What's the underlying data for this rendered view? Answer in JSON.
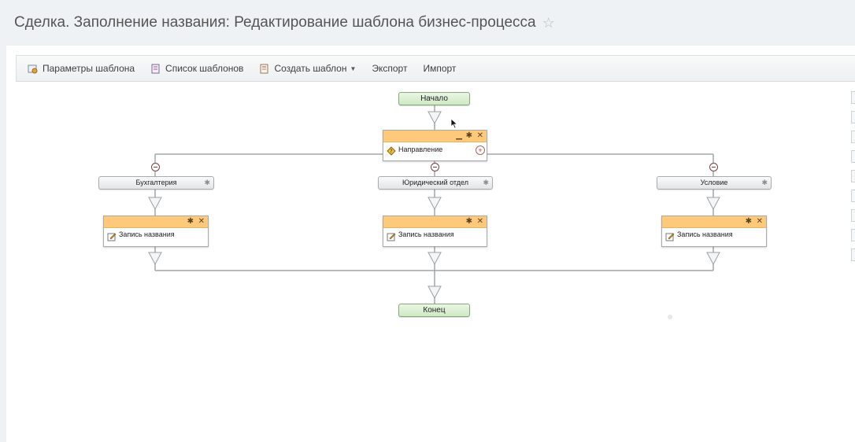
{
  "page": {
    "title": "Сделка. Заполнение названия: Редактирование шаблона бизнес-процесса"
  },
  "toolbar": {
    "template_params": "Параметры шаблона",
    "template_list": "Список шаблонов",
    "create_template": "Создать шаблон",
    "export": "Экспорт",
    "import": "Импорт"
  },
  "diagram": {
    "start": "Начало",
    "end": "Конец",
    "condition_block": {
      "label": "Направление"
    },
    "branches": [
      {
        "label": "Бухгалтерия",
        "activity": "Запись названия"
      },
      {
        "label": "Юридический отдел",
        "activity": "Запись названия"
      },
      {
        "label": "Условие",
        "activity": "Запись названия"
      }
    ]
  },
  "colors": {
    "activity_header": "#fec97a",
    "start_end_node": "#cfe9c4",
    "connector": "#a3a7aa"
  },
  "icons": {
    "star": "star-icon",
    "params": "params-icon",
    "list": "list-icon",
    "create": "create-icon",
    "condition": "condition-icon",
    "activity": "edit-icon"
  }
}
